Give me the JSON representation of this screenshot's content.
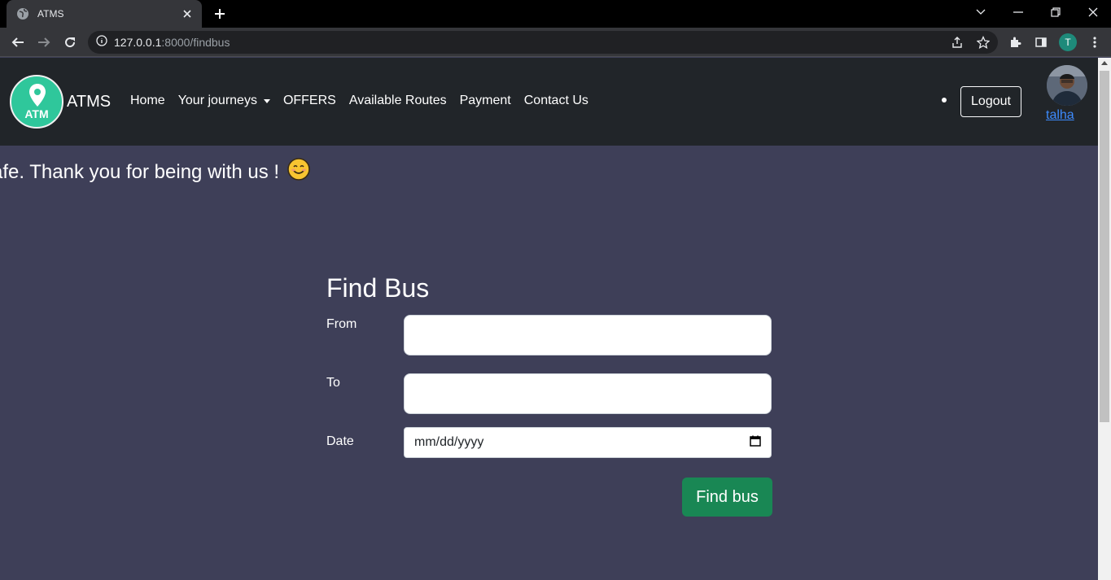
{
  "browser": {
    "tab_title": "ATMS",
    "url_host": "127.0.0.1",
    "url_path": ":8000/findbus",
    "profile_initial": "T"
  },
  "navbar": {
    "logo_text": "ATM",
    "brand": "ATMS",
    "links": [
      "Home",
      "Your journeys",
      "OFFERS",
      "Available Routes",
      "Payment",
      "Contact Us"
    ],
    "logout_label": "Logout",
    "username": "talha"
  },
  "marquee": {
    "text": "afe. Thank you for being with us !"
  },
  "form": {
    "title": "Find Bus",
    "from_label": "From",
    "from_value": "",
    "to_label": "To",
    "to_value": "",
    "date_label": "Date",
    "date_placeholder": "mm/dd/yyyy",
    "submit_label": "Find bus"
  },
  "colors": {
    "page_bg": "#3e3f58",
    "navbar_bg": "#212529",
    "button_green": "#198754",
    "logo_green": "#2fc79b",
    "link_blue": "#3d8bfd"
  }
}
